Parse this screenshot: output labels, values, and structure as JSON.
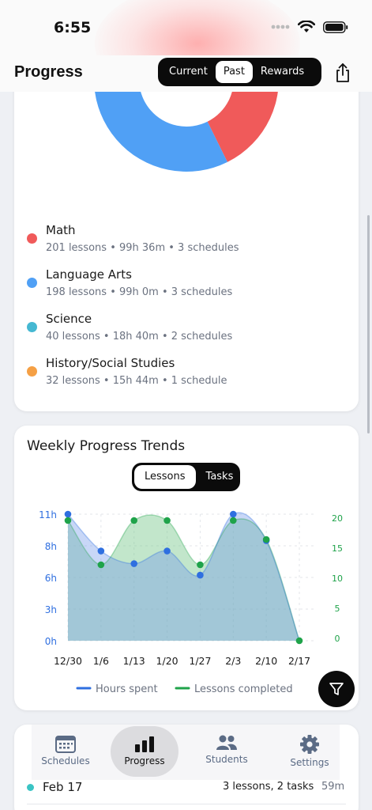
{
  "status_bar": {
    "time": "6:55"
  },
  "header": {
    "title": "Progress",
    "segments": [
      "Current",
      "Past",
      "Rewards"
    ],
    "active_segment": "Past"
  },
  "subject_breakdown": {
    "subjects": [
      {
        "name": "Math",
        "detail": "201 lessons • 99h 36m • 3 schedules",
        "color": "#f05a5a",
        "lessons": 201
      },
      {
        "name": "Language Arts",
        "detail": "198 lessons • 99h 0m • 3 schedules",
        "color": "#50a0f5",
        "lessons": 198
      },
      {
        "name": "Science",
        "detail": "40 lessons • 18h 40m • 2 schedules",
        "color": "#45b8d2",
        "lessons": 40
      },
      {
        "name": "History/Social Studies",
        "detail": "32 lessons • 15h 44m • 1 schedule",
        "color": "#f5a045",
        "lessons": 32
      }
    ]
  },
  "weekly_trends": {
    "title": "Weekly Progress Trends",
    "toggle": [
      "Lessons",
      "Tasks"
    ],
    "active_toggle": "Lessons",
    "legend": {
      "hours": "Hours spent",
      "lessons": "Lessons completed"
    }
  },
  "chart_data": {
    "type": "area",
    "x": [
      "12/30",
      "1/6",
      "1/13",
      "1/20",
      "1/27",
      "2/3",
      "2/10",
      "2/17"
    ],
    "series": [
      {
        "name": "Hours spent",
        "axis": "left",
        "color": "#2f6fe0",
        "values": [
          11,
          7.8,
          6.7,
          7.8,
          5.7,
          11,
          8.7,
          0
        ]
      },
      {
        "name": "Lessons completed",
        "axis": "right",
        "color": "#1fa34a",
        "values": [
          19,
          12,
          19,
          19,
          12,
          19,
          16,
          0
        ]
      }
    ],
    "y_left": {
      "ticks": [
        "0h",
        "3h",
        "6h",
        "8h",
        "11h"
      ],
      "range": [
        0,
        11
      ]
    },
    "y_right": {
      "ticks": [
        "0",
        "5",
        "10",
        "15",
        "20"
      ],
      "range": [
        0,
        20
      ]
    },
    "grid": true
  },
  "recent": {
    "date": "Feb 17",
    "summary": "3 lessons, 2 tasks",
    "duration": "59m"
  },
  "tabbar": {
    "tabs": [
      {
        "label": "Schedules",
        "icon": "calendar-icon"
      },
      {
        "label": "Progress",
        "icon": "bar-chart-icon"
      },
      {
        "label": "Students",
        "icon": "people-icon"
      },
      {
        "label": "Settings",
        "icon": "gear-icon"
      }
    ],
    "active": "Progress"
  }
}
